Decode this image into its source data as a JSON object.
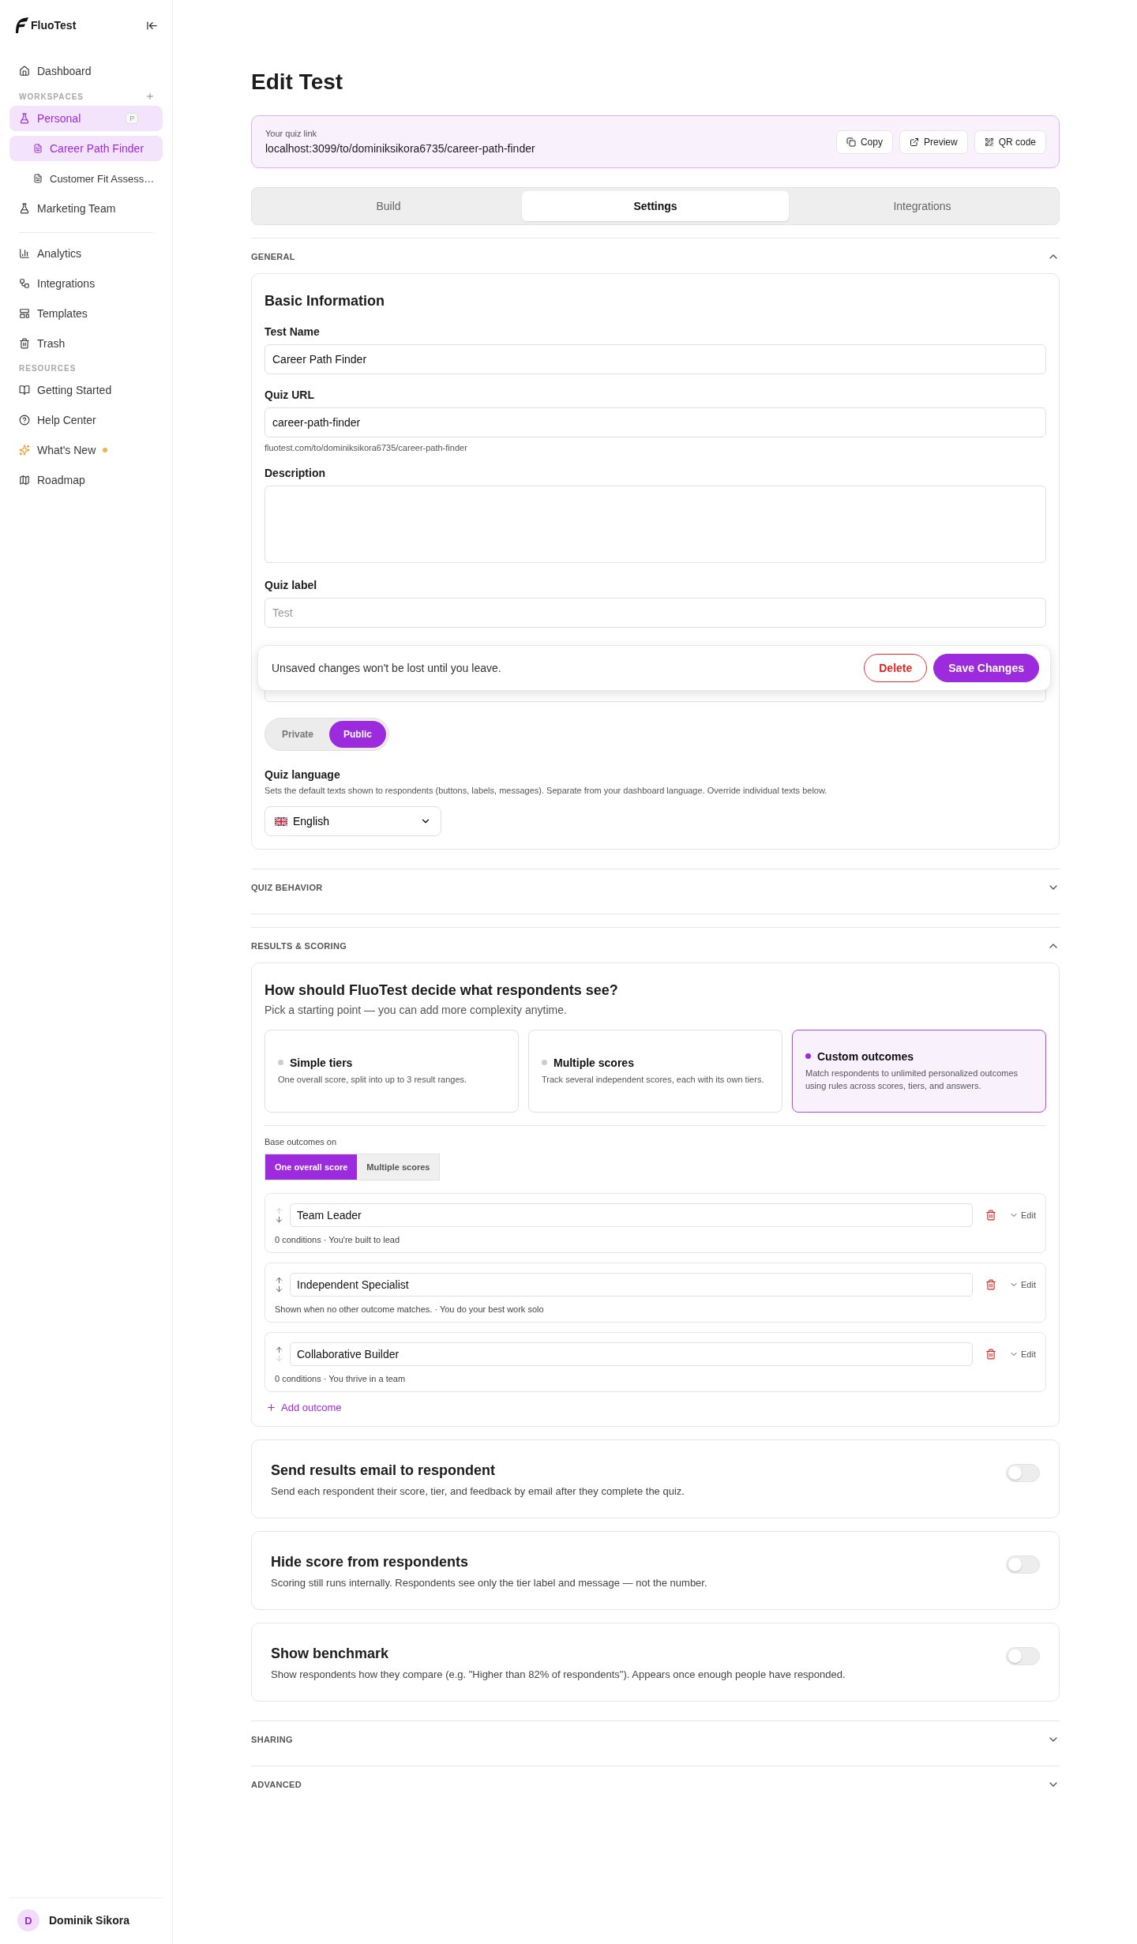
{
  "sidebar": {
    "brand": "FluoTest",
    "top_items": [
      {
        "label": "Dashboard",
        "kind": "home",
        "selected": false
      }
    ],
    "workspaces_label": "WORKSPACES",
    "workspaces": [
      {
        "label": "Personal",
        "badge": "P",
        "selected": true,
        "children": [
          {
            "label": "Career Path Finder",
            "selected": true
          },
          {
            "label": "Customer Fit Assess…",
            "selected": false
          }
        ]
      },
      {
        "label": "Marketing Team",
        "selected": false
      }
    ],
    "main_items": [
      {
        "label": "Analytics",
        "kind": "chart",
        "selected": false
      },
      {
        "label": "Integrations",
        "kind": "workflow",
        "selected": false
      },
      {
        "label": "Templates",
        "kind": "template",
        "selected": false
      },
      {
        "label": "Trash",
        "kind": "trash",
        "selected": false
      }
    ],
    "resources_label": "RESOURCES",
    "resources": [
      {
        "label": "Getting Started",
        "kind": "book",
        "dot": false
      },
      {
        "label": "Help Center",
        "kind": "help",
        "dot": false
      },
      {
        "label": "What's New",
        "kind": "sparkles",
        "dot": true
      },
      {
        "label": "Roadmap",
        "kind": "map",
        "dot": false
      }
    ],
    "user": {
      "initial": "D",
      "name": "Dominik Sikora"
    }
  },
  "page": {
    "title": "Edit Test"
  },
  "quiz_link": {
    "label": "Your quiz link",
    "url": "localhost:3099/to/dominiksikora6735/career-path-finder",
    "actions": [
      {
        "label": "Copy",
        "kind": "copy"
      },
      {
        "label": "Preview",
        "kind": "external"
      },
      {
        "label": "QR code",
        "kind": "qr"
      }
    ]
  },
  "tabs": [
    {
      "label": "Build",
      "selected": false
    },
    {
      "label": "Settings",
      "selected": true
    },
    {
      "label": "Integrations",
      "selected": false
    }
  ],
  "general": {
    "title": "GENERAL",
    "expanded": true,
    "heading": "Basic Information",
    "fields": [
      {
        "kind": "input",
        "label": "Test Name",
        "value": "Career Path Finder"
      },
      {
        "kind": "input",
        "label": "Quiz URL",
        "value": "career-path-finder",
        "hint": "fluotest.com/to/dominiksikora6735/career-path-finder"
      },
      {
        "kind": "textarea",
        "label": "Description"
      },
      {
        "kind": "input",
        "label": "Quiz label",
        "placeholder": "Test"
      }
    ],
    "visibility": [
      {
        "label": "Private",
        "selected": false
      },
      {
        "label": "Public",
        "selected": true
      }
    ],
    "language": {
      "label": "Quiz language",
      "description": "Sets the default texts shown to respondents (buttons, labels, messages). Separate from your dashboard language. Override individual texts below.",
      "value": "English"
    }
  },
  "toast": {
    "message": "Unsaved changes won't be lost until you leave.",
    "buttons": [
      {
        "label": "Delete",
        "kind": "danger"
      },
      {
        "label": "Save Changes",
        "kind": "primary"
      }
    ]
  },
  "quiz_behavior": {
    "title": "QUIZ BEHAVIOR",
    "expanded": false
  },
  "results": {
    "title": "RESULTS & SCORING",
    "expanded": true,
    "heading": "How should FluoTest decide what respondents see?",
    "subheading": "Pick a starting point — you can add more complexity anytime.",
    "modes": [
      {
        "title": "Simple tiers",
        "description": "One overall score, split into up to 3 result ranges.",
        "selected": false
      },
      {
        "title": "Multiple scores",
        "description": "Track several independent scores, each with its own tiers.",
        "selected": false
      },
      {
        "title": "Custom outcomes",
        "description": "Match respondents to unlimited personalized outcomes using rules across scores, tiers, and answers.",
        "selected": true
      }
    ],
    "base_label": "Base outcomes on",
    "base_options": [
      {
        "label": "One overall score",
        "selected": true
      },
      {
        "label": "Multiple scores",
        "selected": false
      }
    ],
    "outcomes": [
      {
        "name": "Team Leader",
        "summary": "0 conditions · You're built to lead",
        "edit": "Edit",
        "can_move_up": false,
        "can_move_down": true
      },
      {
        "name": "Independent Specialist",
        "summary": "Shown when no other outcome matches. · You do your best work solo",
        "edit": "Edit",
        "can_move_up": true,
        "can_move_down": true
      },
      {
        "name": "Collaborative Builder",
        "summary": "0 conditions · You thrive in a team",
        "edit": "Edit",
        "can_move_up": true,
        "can_move_down": false
      }
    ],
    "add_label": "Add outcome",
    "toggles": [
      {
        "title": "Send results email to respondent",
        "description": "Send each respondent their score, tier, and feedback by email after they complete the quiz.",
        "on": false
      },
      {
        "title": "Hide score from respondents",
        "description": "Scoring still runs internally. Respondents see only the tier label and message — not the number.",
        "on": false
      },
      {
        "title": "Show benchmark",
        "description": "Show respondents how they compare (e.g. \"Higher than 82% of respondents\"). Appears once enough people have responded.",
        "on": false
      }
    ]
  },
  "sharing": {
    "title": "SHARING",
    "expanded": false
  },
  "advanced": {
    "title": "ADVANCED",
    "expanded": false
  }
}
